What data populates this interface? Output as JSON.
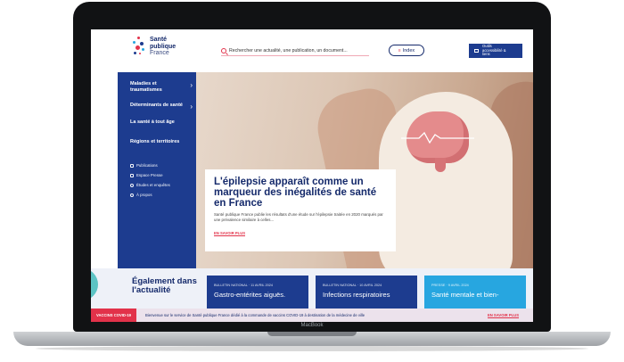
{
  "device": {
    "label": "MacBook"
  },
  "header": {
    "logo_line1": "Santé",
    "logo_line2": "publique",
    "logo_line3": "France",
    "search_placeholder": "Rechercher une actualité, une publication, un document...",
    "index_label": "Index",
    "access_label": "Outils accessibilité & liens"
  },
  "sidebar": {
    "items": [
      {
        "label": "Maladies et traumatismes"
      },
      {
        "label": "Déterminants de santé"
      },
      {
        "label": "La santé à tout âge"
      },
      {
        "label": "Régions et territoires"
      }
    ],
    "links": [
      {
        "label": "Publications"
      },
      {
        "label": "Espace Presse"
      },
      {
        "label": "Études et enquêtes"
      },
      {
        "label": "À propos"
      }
    ]
  },
  "hero": {
    "title": "L'épilepsie apparaît comme un marqueur des inégalités de santé en France",
    "text": "Santé publique France publie les résultats d'une étude sur l'épilepsie traitée en 2020 marqués par une prévalence similaire à celles...",
    "link": "EN SAVOIR PLUS"
  },
  "lower": {
    "also_title": "Également dans l'actualité",
    "news": [
      {
        "meta": "BULLETIN NATIONAL · 11 AVRIL 2024",
        "title": "Gastro-entérites aiguës."
      },
      {
        "meta": "BULLETIN NATIONAL · 10 AVRIL 2024",
        "title": "Infections respiratoires"
      },
      {
        "meta": "PRESSE · 9 AVRIL 2024",
        "title": "Santé mentale et bien-"
      }
    ]
  },
  "banner": {
    "tag": "VACCINS COVID-19",
    "text": "Bienvenue sur le service de Santé publique France dédié à la commande de vaccins COVID-19 à destination de la médecine de ville",
    "link": "EN SAVOIR PLUS"
  },
  "colors": {
    "brand_blue": "#1d3c8f",
    "accent_red": "#e2324a",
    "light_blue": "#27a6e0"
  }
}
